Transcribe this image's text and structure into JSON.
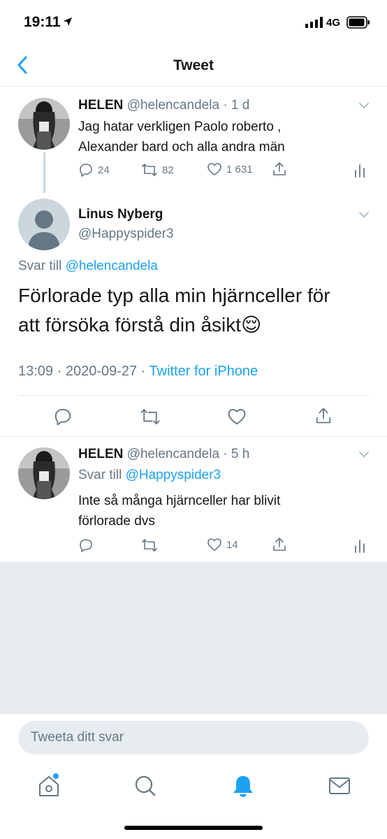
{
  "status_bar": {
    "time": "19:11",
    "network": "4G"
  },
  "header": {
    "title": "Tweet"
  },
  "tweets": [
    {
      "name": "HELEN",
      "handle": "@helencandela",
      "time": "· 1 d",
      "text_line1": "Jag hatar verkligen Paolo roberto ,",
      "text_line2": "Alexander bard och alla andra män",
      "replies": "24",
      "retweets": "82",
      "likes": "1 631"
    },
    {
      "name": "Linus Nyberg",
      "handle": "@Happyspider3",
      "reply_prefix": "Svar till",
      "reply_to": "@helencandela",
      "text_line1": "Förlorade typ alla min hjärnceller för",
      "text_line2": "att försöka förstå din åsikt😌",
      "timestamp": "13:09 · 2020-09-27 ·",
      "source": "Twitter for iPhone"
    },
    {
      "name": "HELEN",
      "handle": "@helencandela",
      "time": "· 5 h",
      "reply_prefix": "Svar till",
      "reply_to": "@Happyspider3",
      "text_line1": "Inte så många hjärnceller har blivit",
      "text_line2": "förlorade dvs",
      "likes": "14"
    }
  ],
  "reply": {
    "placeholder": "Tweeta ditt svar"
  },
  "tabs": [
    "home-icon",
    "search-icon",
    "notifications-icon",
    "messages-icon"
  ],
  "colors": {
    "accent": "#1da1f2",
    "muted": "#657786",
    "text": "#14171a",
    "divider": "#e1e8ed",
    "background_gray": "#e6ecf0"
  }
}
